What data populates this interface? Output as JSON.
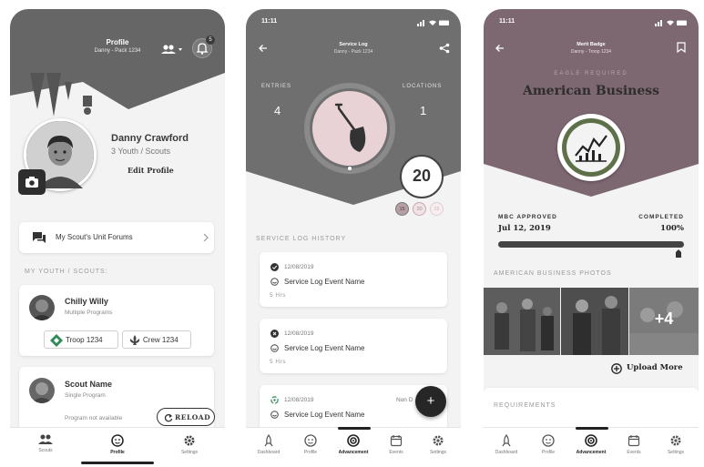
{
  "screen1": {
    "header_title": "Profile",
    "header_subtitle": "Danny - Pack 1234",
    "bell_badge": "5",
    "profile_name": "Danny Crawford",
    "profile_meta": "3 Youth / Scouts",
    "edit_profile": "Edit Profile",
    "forums_label": "My Scout's Unit Forums",
    "section_youth": "MY YOUTH / SCOUTS:",
    "scouts": [
      {
        "name": "Chilly Willy",
        "program": "Multiple Programs",
        "units": [
          "Troop 1234",
          "Crew 1234"
        ]
      },
      {
        "name": "Scout Name",
        "program": "Single Program",
        "note": "Program not available",
        "reload": "RELOAD"
      }
    ],
    "nav": [
      "Scouts",
      "Profile",
      "Settings"
    ]
  },
  "screen2": {
    "status_time": "11:11",
    "header_title": "Service Log",
    "header_subtitle": "Danny - Pack 1234",
    "entries_label": "ENTRIES",
    "entries_value": "4",
    "locations_label": "LOCATIONS",
    "locations_value": "1",
    "total": "20",
    "chips": [
      "15",
      "20",
      "25"
    ],
    "section_history": "SERVICE LOG HISTORY",
    "logs": [
      {
        "date": "12/08/2019",
        "event": "Service Log Event Name",
        "hours": "5 Hrs"
      },
      {
        "date": "12/08/2019",
        "event": "Service Log Event Name",
        "hours": "5 Hrs"
      },
      {
        "date": "12/08/2019",
        "event": "Service Log Event Name",
        "right": "Non D"
      }
    ],
    "fab": "+",
    "nav": [
      "Dashboard",
      "Profile",
      "Advancement",
      "Events",
      "Settings"
    ]
  },
  "screen3": {
    "status_time": "11:11",
    "header_title": "Merit Badge",
    "header_subtitle": "Danny - Troop 1234",
    "eyebrow": "EAGLE REQUIRED",
    "badge_title": "American Business",
    "approved_label": "MBC APPROVED",
    "approved_date": "Jul 12, 2019",
    "completed_label": "COMPLETED",
    "completed_value": "100%",
    "progress": 1.0,
    "photos_label": "AMERICAN BUSINESS PHOTOS",
    "more_photos": "+4",
    "upload": "Upload More",
    "requirements_label": "REQUIREMENTS",
    "nav": [
      "Dashboard",
      "Profile",
      "Advancement",
      "Events",
      "Settings"
    ]
  },
  "colors": {
    "header_grey": "#6e6e6e",
    "mauve": "#7d6770",
    "dark": "#2b2b2b",
    "troop_green": "#2e8b57"
  }
}
